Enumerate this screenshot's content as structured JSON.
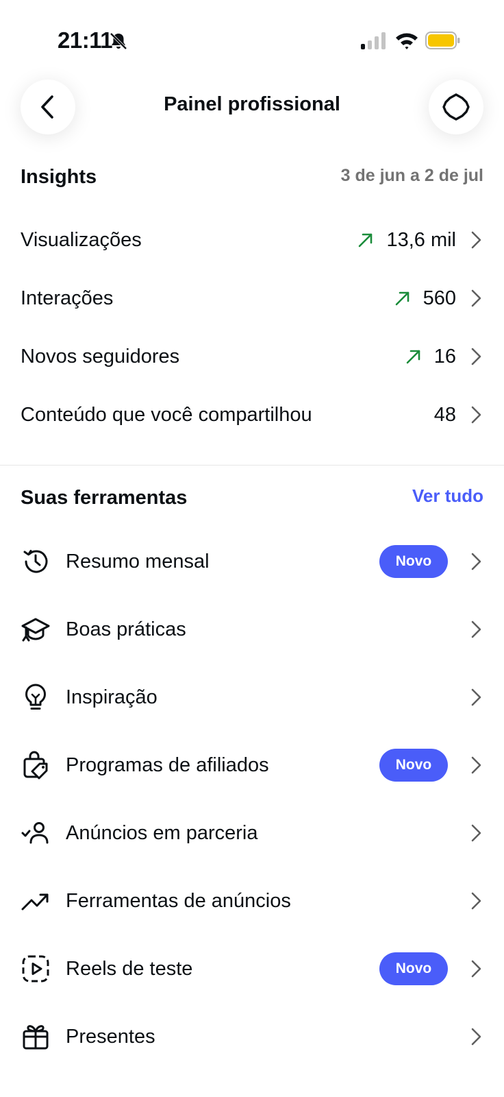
{
  "status_bar": {
    "time": "21:11"
  },
  "header": {
    "title": "Painel profissional"
  },
  "insights": {
    "title": "Insights",
    "date_range": "3 de jun a 2 de jul",
    "trend_color": "#1a8c3a",
    "metrics": [
      {
        "label": "Visualizações",
        "value": "13,6 mil",
        "trend": "up"
      },
      {
        "label": "Interações",
        "value": "560",
        "trend": "up"
      },
      {
        "label": "Novos seguidores",
        "value": "16",
        "trend": "up"
      },
      {
        "label": "Conteúdo que você compartilhou",
        "value": "48",
        "trend": "none"
      }
    ]
  },
  "tools": {
    "title": "Suas ferramentas",
    "see_all": "Ver tudo",
    "accent_color": "#4a5df9",
    "items": [
      {
        "label": "Resumo mensal",
        "icon": "history-icon",
        "badge": "Novo"
      },
      {
        "label": "Boas práticas",
        "icon": "graduation-cap-icon",
        "badge": ""
      },
      {
        "label": "Inspiração",
        "icon": "lightbulb-icon",
        "badge": ""
      },
      {
        "label": "Programas de afiliados",
        "icon": "shopping-tag-icon",
        "badge": "Novo"
      },
      {
        "label": "Anúncios em parceria",
        "icon": "person-check-icon",
        "badge": ""
      },
      {
        "label": "Ferramentas de anúncios",
        "icon": "trending-up-icon",
        "badge": ""
      },
      {
        "label": "Reels de teste",
        "icon": "reels-test-icon",
        "badge": "Novo"
      },
      {
        "label": "Presentes",
        "icon": "gift-icon",
        "badge": ""
      }
    ]
  }
}
